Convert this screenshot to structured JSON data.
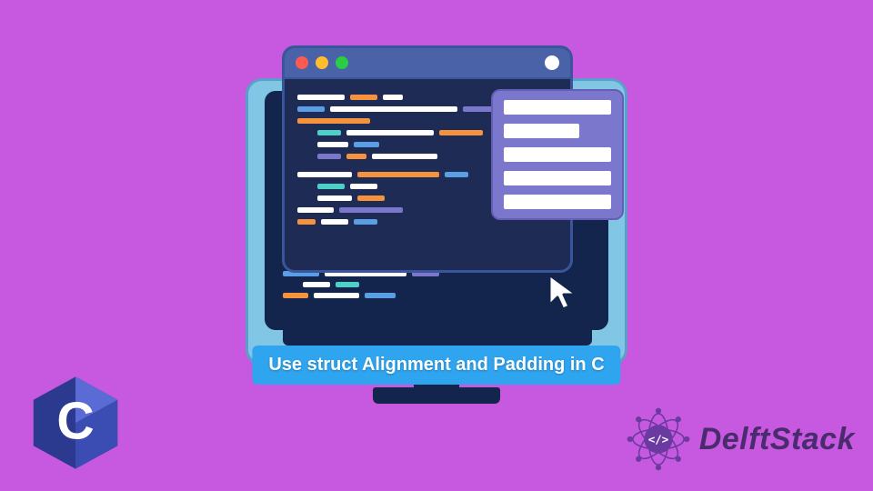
{
  "caption": "Use struct Alignment and Padding in C",
  "brand": {
    "name": "DelftStack",
    "tagline_icon": "code-brackets-icon"
  },
  "language_badge": {
    "letter": "C",
    "name": "c-language"
  },
  "window": {
    "traffic_lights": [
      "red",
      "yellow",
      "green"
    ]
  },
  "list_panel": {
    "rows": 5
  },
  "colors": {
    "background": "#c659e0",
    "caption_bg": "#2fa4ef",
    "caption_fg": "#ffffff",
    "panel": "#7a77cc",
    "code_bg": "#1d2b55",
    "monitor_frame": "#82c6e6",
    "brand_text": "#4a2b6d"
  }
}
